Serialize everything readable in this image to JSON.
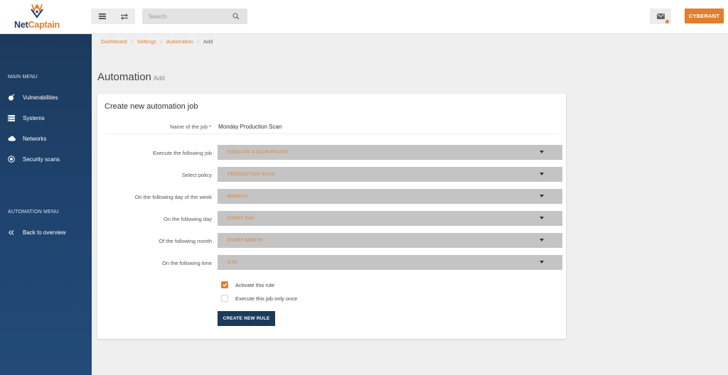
{
  "brand": {
    "logo_text_primary": "Net",
    "logo_text_accent": "Captain",
    "accent_color": "#e07f2d",
    "navy_color": "#1d3a5b"
  },
  "header": {
    "search_placeholder": "Search",
    "user_label": "CYBERANT",
    "icons": [
      "menu-icon",
      "swap-icon",
      "search-icon",
      "mail-icon"
    ]
  },
  "sidebar": {
    "main_menu_title": "MAIN MENU",
    "main_items": [
      {
        "label": "Vulnerabilities",
        "icon": "bomb-icon"
      },
      {
        "label": "Systems",
        "icon": "server-icon"
      },
      {
        "label": "Networks",
        "icon": "cloud-icon"
      },
      {
        "label": "Security scans",
        "icon": "target-icon"
      }
    ],
    "automation_menu_title": "AUTOMATION MENU",
    "automation_items": [
      {
        "label": "Back to overview",
        "icon": "double-chevron-left-icon"
      }
    ]
  },
  "breadcrumb": {
    "items": [
      "Dashboard",
      "Settings",
      "Automation"
    ],
    "current": "Add"
  },
  "page": {
    "title": "Automation",
    "subtitle": "Add"
  },
  "form": {
    "card_title": "Create new automation job",
    "job_name_label": "Name of the job *",
    "job_name_value": "Monday Production Scan",
    "fields": [
      {
        "label": "Execute the following job",
        "value": "EXECUTE A SCAN POLICY"
      },
      {
        "label": "Select policy",
        "value": "PRODUCTION SCAN"
      },
      {
        "label": "On the following day of the week",
        "value": "MONDAY"
      },
      {
        "label": "On the following day",
        "value": "EVERY DAY"
      },
      {
        "label": "Of the following month",
        "value": "EVERY MONTH"
      },
      {
        "label": "On the following time",
        "value": "9:00"
      }
    ],
    "checkboxes": [
      {
        "label": "Activate this rule",
        "checked": true
      },
      {
        "label": "Execute this job only once",
        "checked": false
      }
    ],
    "submit_label": "CREATE NEW RULE"
  }
}
